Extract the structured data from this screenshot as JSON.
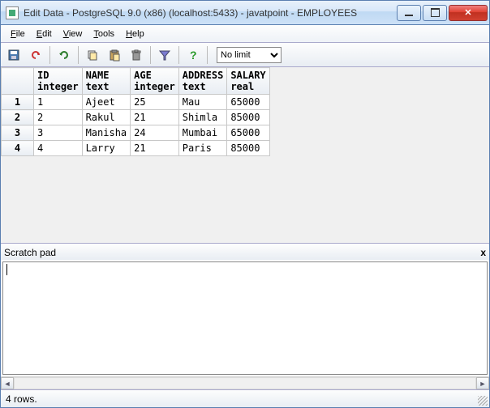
{
  "window": {
    "title": "Edit Data - PostgreSQL 9.0 (x86) (localhost:5433) - javatpoint - EMPLOYEES"
  },
  "menu": {
    "file": "File",
    "edit": "Edit",
    "view": "View",
    "tools": "Tools",
    "help": "Help"
  },
  "toolbar": {
    "limit_value": "No limit"
  },
  "columns": [
    {
      "name": "ID",
      "type": "integer"
    },
    {
      "name": "NAME",
      "type": "text"
    },
    {
      "name": "AGE",
      "type": "integer"
    },
    {
      "name": "ADDRESS",
      "type": "text"
    },
    {
      "name": "SALARY",
      "type": "real"
    }
  ],
  "rows": [
    {
      "n": "1",
      "ID": "1",
      "NAME": "Ajeet",
      "AGE": "25",
      "ADDRESS": "Mau",
      "SALARY": "65000"
    },
    {
      "n": "2",
      "ID": "2",
      "NAME": "Rakul",
      "AGE": "21",
      "ADDRESS": "Shimla",
      "SALARY": "85000"
    },
    {
      "n": "3",
      "ID": "3",
      "NAME": "Manisha",
      "AGE": "24",
      "ADDRESS": "Mumbai",
      "SALARY": "65000"
    },
    {
      "n": "4",
      "ID": "4",
      "NAME": "Larry",
      "AGE": "21",
      "ADDRESS": "Paris",
      "SALARY": "85000"
    }
  ],
  "scratch": {
    "title": "Scratch pad",
    "close": "x"
  },
  "status": {
    "text": "4 rows."
  },
  "icons": {
    "save": "save-icon",
    "undo": "undo-icon",
    "refresh": "refresh-icon",
    "copy": "copy-icon",
    "paste": "paste-icon",
    "delete": "delete-icon",
    "filter": "filter-icon",
    "help": "help-icon"
  }
}
